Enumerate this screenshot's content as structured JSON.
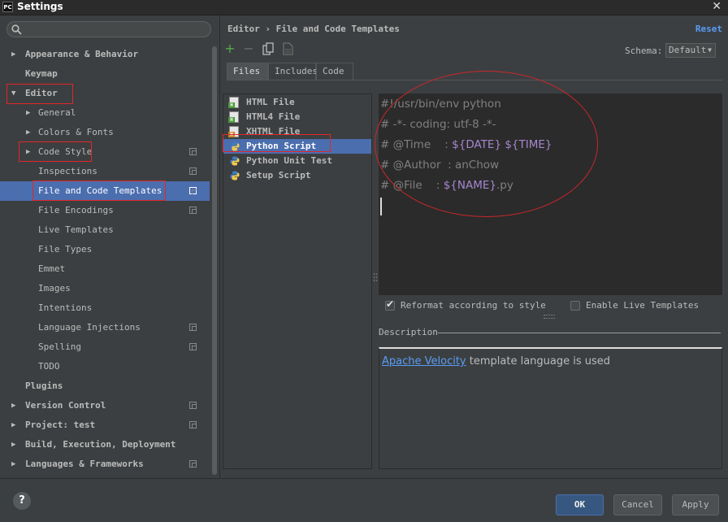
{
  "window": {
    "app_icon_text": "PC",
    "title": "Settings",
    "close_glyph": "✕"
  },
  "sidebar": {
    "search_placeholder": "",
    "items": [
      {
        "label": "Appearance & Behavior",
        "arrow": "▶"
      },
      {
        "label": "Keymap",
        "arrow": ""
      },
      {
        "label": "Editor",
        "arrow": "▼"
      },
      {
        "label": "General",
        "arrow": "▶"
      },
      {
        "label": "Colors & Fonts",
        "arrow": "▶"
      },
      {
        "label": "Code Style",
        "arrow": "▶"
      },
      {
        "label": "Inspections",
        "arrow": ""
      },
      {
        "label": "File and Code Templates",
        "arrow": ""
      },
      {
        "label": "File Encodings",
        "arrow": ""
      },
      {
        "label": "Live Templates",
        "arrow": ""
      },
      {
        "label": "File Types",
        "arrow": ""
      },
      {
        "label": "Emmet",
        "arrow": ""
      },
      {
        "label": "Images",
        "arrow": ""
      },
      {
        "label": "Intentions",
        "arrow": ""
      },
      {
        "label": "Language Injections",
        "arrow": ""
      },
      {
        "label": "Spelling",
        "arrow": ""
      },
      {
        "label": "TODO",
        "arrow": ""
      },
      {
        "label": "Plugins",
        "arrow": ""
      },
      {
        "label": "Version Control",
        "arrow": "▶"
      },
      {
        "label": "Project: test",
        "arrow": "▶"
      },
      {
        "label": "Build, Execution, Deployment",
        "arrow": "▶"
      },
      {
        "label": "Languages & Frameworks",
        "arrow": "▶"
      }
    ]
  },
  "main": {
    "breadcrumb": "Editor › File and Code Templates",
    "reset_label": "Reset",
    "toolbar": {
      "add": "+",
      "remove": "−"
    },
    "schema": {
      "label": "Schema:",
      "value": "Default"
    },
    "tabs": [
      "Files",
      "Includes",
      "Code"
    ],
    "templates": [
      {
        "name": "HTML File",
        "tag": "H",
        "tag_color": "#4a9a3c"
      },
      {
        "name": "HTML4 File",
        "tag": "H",
        "tag_color": "#4a9a3c"
      },
      {
        "name": "XHTML File",
        "tag": "H",
        "tag_color": "#c8852b"
      },
      {
        "name": "Python Script",
        "tag": "py",
        "tag_color": ""
      },
      {
        "name": "Python Unit Test",
        "tag": "py",
        "tag_color": ""
      },
      {
        "name": "Setup Script",
        "tag": "py",
        "tag_color": ""
      }
    ],
    "code": {
      "line1": "#!/usr/bin/env python",
      "line2": "# -*- coding: utf-8 -*-",
      "line3_prefix": "# @Time    : ",
      "line3_var1": "${DATE}",
      "line3_var2": "${TIME}",
      "line4": "# @Author  : anChow",
      "line5_prefix": "# @File    : ",
      "line5_var": "${NAME}",
      "line5_suffix": ".py"
    },
    "reformat": {
      "label": "Reformat according to style",
      "checked": true
    },
    "live_templates": {
      "label": "Enable Live Templates",
      "checked": false
    },
    "description": {
      "title": "Description",
      "link": "Apache Velocity",
      "text": " template language is used"
    }
  },
  "footer": {
    "help": "?",
    "ok": "OK",
    "cancel": "Cancel",
    "apply": "Apply"
  },
  "colors": {
    "selection": "#4b6eaf",
    "highlight_box": "#e0262a",
    "link": "#589df6",
    "template_var": "#a587cf"
  }
}
